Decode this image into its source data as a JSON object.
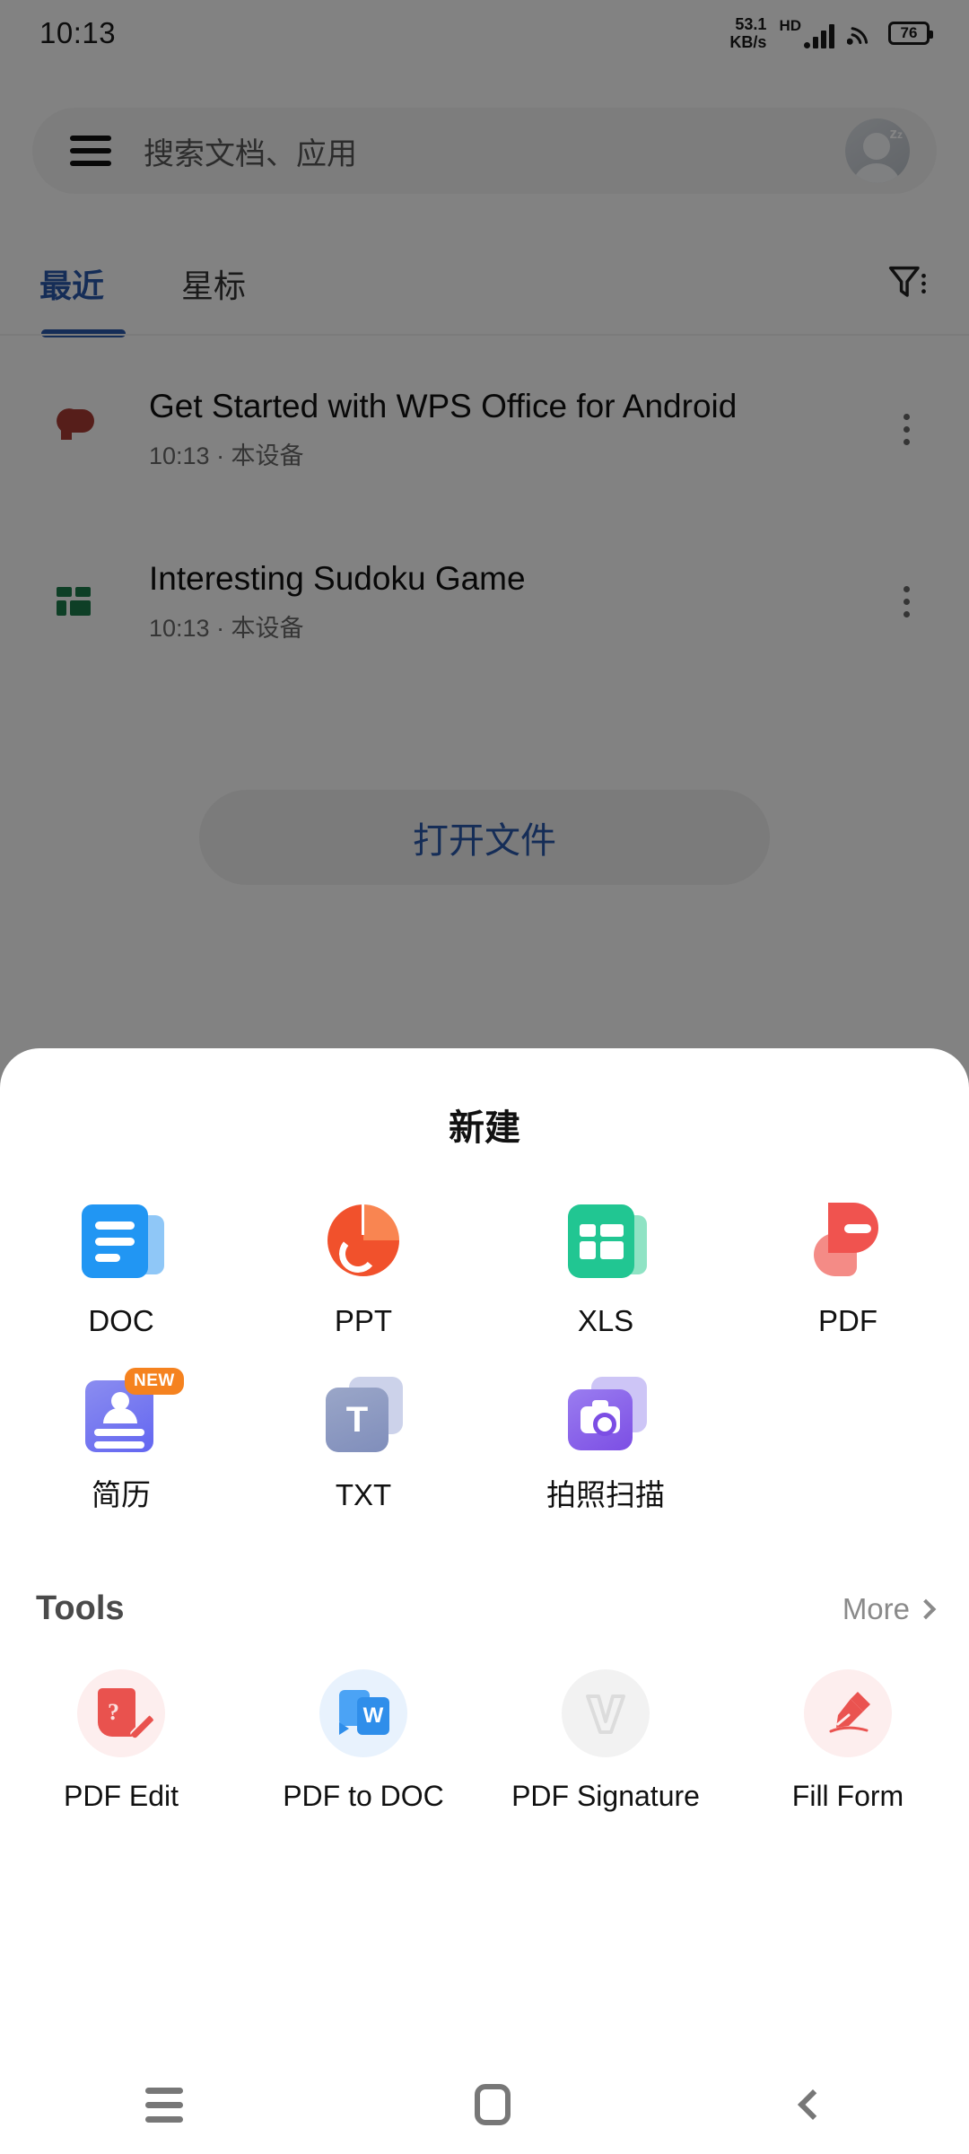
{
  "status_bar": {
    "time": "10:13",
    "net_speed_value": "53.1",
    "net_speed_unit": "KB/s",
    "hd_label": "HD",
    "battery_percent": "76",
    "icons": [
      "signal-icon",
      "wifi-icon",
      "battery-icon"
    ]
  },
  "search": {
    "placeholder": "搜索文档、应用",
    "menu_icon": "hamburger-menu-icon",
    "avatar_icon": "user-avatar-icon"
  },
  "tabs": [
    {
      "label": "最近",
      "active": true
    },
    {
      "label": "星标",
      "active": false
    }
  ],
  "filter_icon": "filter-icon",
  "files": [
    {
      "title": "Get Started with WPS Office for Android",
      "meta": "10:13 · 本设备",
      "icon": "pdf-file-icon",
      "icon_color": "#a63a33"
    },
    {
      "title": "Interesting Sudoku Game",
      "meta": "10:13 · 本设备",
      "icon": "xls-file-icon",
      "icon_color": "#1c7a4a"
    }
  ],
  "open_file_button": "打开文件",
  "sheet": {
    "title": "新建",
    "create_items": [
      {
        "label": "DOC",
        "icon": "doc-icon",
        "badge": ""
      },
      {
        "label": "PPT",
        "icon": "ppt-icon",
        "badge": ""
      },
      {
        "label": "XLS",
        "icon": "xls-icon",
        "badge": ""
      },
      {
        "label": "PDF",
        "icon": "pdf-icon",
        "badge": ""
      },
      {
        "label": "简历",
        "icon": "resume-icon",
        "badge": "NEW"
      },
      {
        "label": "TXT",
        "icon": "txt-icon",
        "badge": ""
      },
      {
        "label": "拍照扫描",
        "icon": "camera-scan-icon",
        "badge": ""
      }
    ],
    "tools": {
      "title": "Tools",
      "more_label": "More",
      "more_icon": "chevron-right-icon",
      "items": [
        {
          "label": "PDF Edit",
          "icon": "pdf-edit-icon"
        },
        {
          "label": "PDF to DOC",
          "icon": "pdf-to-doc-icon"
        },
        {
          "label": "PDF Signature",
          "icon": "pdf-signature-icon"
        },
        {
          "label": "Fill Form",
          "icon": "fill-form-icon"
        }
      ]
    }
  },
  "nav_bar": {
    "recents_icon": "recents-icon",
    "home_icon": "home-icon",
    "back_icon": "back-icon"
  },
  "colors": {
    "accent_blue": "#2a56a8",
    "doc_blue": "#2196f3",
    "ppt_orange": "#f1512c",
    "xls_green": "#21c692",
    "pdf_red": "#f0534f",
    "resume_purple": "#6366f1",
    "scan_purple": "#7c4ee4",
    "badge_orange": "#f5821f"
  }
}
